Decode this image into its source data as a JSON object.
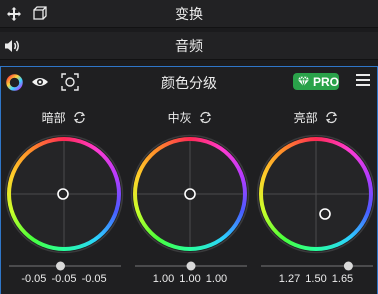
{
  "sections": {
    "transform": {
      "title": "变换",
      "icons": [
        "move-icon",
        "cube-icon"
      ]
    },
    "audio": {
      "title": "音频",
      "icons": [
        "speaker-icon"
      ]
    }
  },
  "color_grading": {
    "title": "颜色分级",
    "pro_badge": "PRO",
    "accent_color": "#2f76c8",
    "pro_color": "#2aa24a",
    "wheels": [
      {
        "label": "暗部",
        "value_1": "-0.05",
        "value_2": "-0.05",
        "value_3": "-0.05",
        "slider_fraction": 0.46
      },
      {
        "label": "中灰",
        "value_1": "1.00",
        "value_2": "1.00",
        "value_3": "1.00",
        "slider_fraction": 0.5
      },
      {
        "label": "亮部",
        "value_1": "1.27",
        "value_2": "1.50",
        "value_3": "1.65",
        "slider_fraction": 0.78
      }
    ]
  }
}
